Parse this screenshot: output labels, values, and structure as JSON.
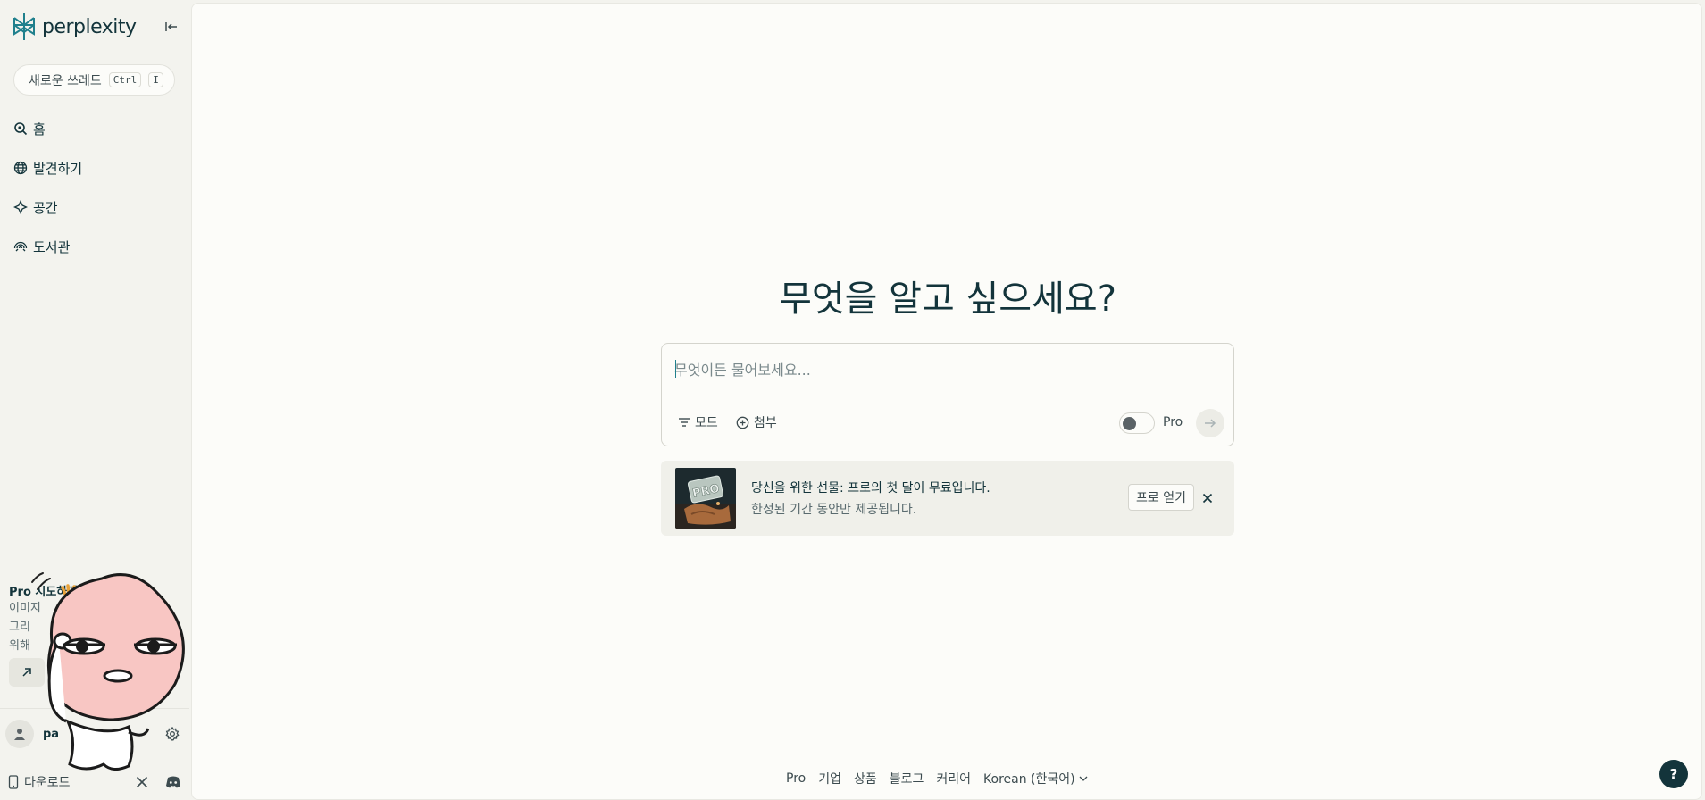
{
  "brand": {
    "name": "perplexity",
    "accent": "#20808d"
  },
  "sidebar": {
    "new_thread": {
      "label": "새로운 쓰레드",
      "key1": "Ctrl",
      "key2": "I"
    },
    "items": [
      {
        "label": "홈",
        "icon": "search-icon"
      },
      {
        "label": "발견하기",
        "icon": "globe-icon"
      },
      {
        "label": "공간",
        "icon": "spaces-icon"
      },
      {
        "label": "도서관",
        "icon": "library-icon"
      }
    ],
    "pro_promo": {
      "title": "Pro 시도하기",
      "line1": "이미지",
      "line2": "그리",
      "line3": "위해"
    },
    "user": {
      "name": "pa"
    },
    "download_label": "다운로드"
  },
  "main": {
    "headline": "무엇을 알고 싶으세요?",
    "search": {
      "placeholder": "무엇이든 물어보세요...",
      "mode_label": "모드",
      "attach_label": "첨부",
      "pro_label": "Pro",
      "pro_enabled": false
    },
    "promo": {
      "title": "당신을 위한 선물: 프로의 첫 달이 무료입니다.",
      "subtitle": "한정된 기간 동안만 제공됩니다.",
      "button": "프로 얻기"
    },
    "footer": {
      "links": [
        "Pro",
        "기업",
        "상품",
        "블로그",
        "커리어"
      ],
      "language": "Korean (한국어)"
    },
    "help_label": "?"
  }
}
